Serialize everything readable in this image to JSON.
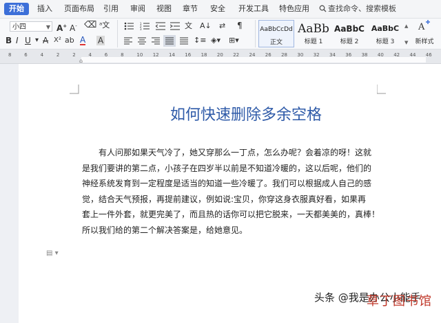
{
  "menubar": {
    "tabs": [
      "开始",
      "插入",
      "页面布局",
      "引用",
      "审阅",
      "视图",
      "章节",
      "安全",
      "开发工具",
      "特色应用"
    ],
    "search_label": "查找命令、搜索模板"
  },
  "ribbon": {
    "font_size": "小四",
    "styles": [
      {
        "sample": "AaBbCcDd",
        "label": "正文"
      },
      {
        "sample": "AaBb",
        "label": "标题 1"
      },
      {
        "sample": "AaBbC",
        "label": "标题 2"
      },
      {
        "sample": "AaBbC",
        "label": "标题 3"
      }
    ],
    "new_style_label": "新样式"
  },
  "ruler": {
    "ticks": [
      "8",
      "6",
      "4",
      "2",
      "2",
      "4",
      "6",
      "8",
      "10",
      "12",
      "14",
      "16",
      "18",
      "20",
      "22",
      "24",
      "26",
      "28",
      "30",
      "32",
      "34",
      "36",
      "38",
      "40",
      "42",
      "44",
      "46"
    ]
  },
  "document": {
    "title": "如何快速删除多余空格",
    "lines": [
      "有人问那如果天气冷了，她又穿那么一丁点，怎么办呢？会着凉的呀！这就",
      "是我们要讲的第二点，小孩子在四岁半以前是不知道冷暖的，这以后呢，他们的",
      "神经系统发育到一定程度是适当的知道一些冷暖了。我们可以根据成人自己的感",
      "觉，结合天气预报，再提前建议，例如说:宝贝，你穿这身衣服真好看，如果再",
      "套上一件外套，就更完美了，而且热的话你可以把它脱来，一天都美美的，真棒！",
      "所以我们给的第二个解决答案是，给她意见。"
    ]
  },
  "watermark": {
    "source": "头条 @我是办公小能手",
    "site": "草丁图书馆"
  },
  "colors": {
    "accent": "#3c6fd8",
    "title": "#2e5aa8"
  }
}
